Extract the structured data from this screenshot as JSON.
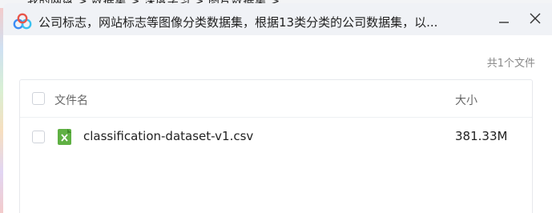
{
  "background_window": {
    "breadcrumbs": "我的网盘  >  数据集  >  深度学习  >  图片数据集  >"
  },
  "dialog": {
    "title": "公司标志，网站标志等图像分类数据集，根据13类分类的公司数据集，以...",
    "app_icon": "baidu-netdisk-cloud-icon",
    "minimize_icon": "minimize-icon",
    "close_icon": "close-icon",
    "file_count": "共1个文件",
    "table": {
      "header": {
        "name": "文件名",
        "size": "大小"
      },
      "rows": [
        {
          "name": "classification-dataset-v1.csv",
          "size": "381.33M",
          "icon": "excel-file-icon"
        }
      ]
    }
  },
  "colors": {
    "titlebar_bg": "#f0f2f6",
    "excel_green": "#5fb043",
    "border": "#e6e8ec"
  }
}
